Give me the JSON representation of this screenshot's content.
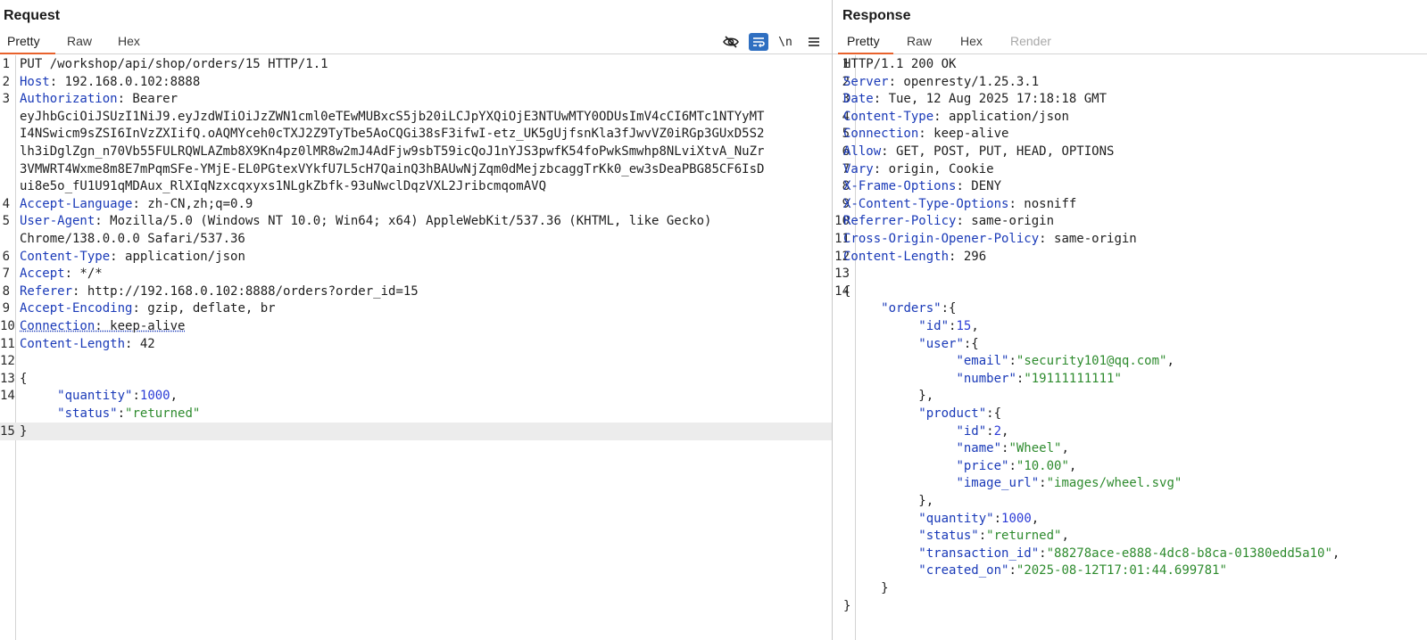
{
  "request": {
    "title": "Request",
    "tabs": [
      "Pretty",
      "Raw",
      "Hex"
    ],
    "active_tab": "Pretty",
    "toolbar": {
      "icons": [
        "hide-eye-icon",
        "wrap-lines-icon",
        "newline-icon",
        "menu-icon"
      ],
      "newline_label": "\\n"
    },
    "lines": [
      {
        "n": "1",
        "parts": [
          {
            "t": "PUT /workshop/api/shop/orders/15 HTTP/1.1",
            "c": "hv"
          }
        ]
      },
      {
        "n": "2",
        "parts": [
          {
            "t": "Host",
            "c": "hk"
          },
          {
            "t": ": 192.168.0.102:8888",
            "c": "hv"
          }
        ]
      },
      {
        "n": "3",
        "parts": [
          {
            "t": "Authorization",
            "c": "hk"
          },
          {
            "t": ": Bearer",
            "c": "hv"
          }
        ]
      },
      {
        "n": "",
        "parts": [
          {
            "t": "eyJhbGciOiJSUzI1NiJ9.eyJzdWIiOiJzZWN1cml0eTEwMUBxcS5jb20iLCJpYXQiOjE3NTUwMTY0ODUsImV4cCI6MTc1NTYyMT",
            "c": "hv"
          }
        ]
      },
      {
        "n": "",
        "parts": [
          {
            "t": "I4NSwicm9sZSI6InVzZXIifQ.oAQMYceh0cTXJ2Z9TyTbe5AoCQGi38sF3ifwI-etz_UK5gUjfsnKla3fJwvVZ0iRGp3GUxD5S2",
            "c": "hv"
          }
        ]
      },
      {
        "n": "",
        "parts": [
          {
            "t": "lh3iDglZgn_n70Vb55FULRQWLAZmb8X9Kn4pz0lMR8w2mJ4AdFjw9sbT59icQoJ1nYJS3pwfK54foPwkSmwhp8NLviXtvA_NuZr",
            "c": "hv"
          }
        ]
      },
      {
        "n": "",
        "parts": [
          {
            "t": "3VMWRT4Wxme8m8E7mPqmSFe-YMjE-EL0PGtexVYkfU7L5cH7QainQ3hBAUwNjZqm0dMejzbcaggTrKk0_ew3sDeaPBG85CF6IsD",
            "c": "hv"
          }
        ]
      },
      {
        "n": "",
        "parts": [
          {
            "t": "ui8e5o_fU1U91qMDAux_RlXIqNzxcqxyxs1NLgkZbfk-93uNwclDqzVXL2JribcmqomAVQ",
            "c": "hv"
          }
        ]
      },
      {
        "n": "4",
        "parts": [
          {
            "t": "Accept-Language",
            "c": "hk"
          },
          {
            "t": ": zh-CN,zh;q=0.9",
            "c": "hv"
          }
        ]
      },
      {
        "n": "5",
        "parts": [
          {
            "t": "User-Agent",
            "c": "hk"
          },
          {
            "t": ": Mozilla/5.0 (Windows NT 10.0; Win64; x64) AppleWebKit/537.36 (KHTML, like Gecko)",
            "c": "hv"
          }
        ]
      },
      {
        "n": "",
        "parts": [
          {
            "t": "Chrome/138.0.0.0 Safari/537.36",
            "c": "hv"
          }
        ]
      },
      {
        "n": "6",
        "parts": [
          {
            "t": "Content-Type",
            "c": "hk"
          },
          {
            "t": ": application/json",
            "c": "hv"
          }
        ]
      },
      {
        "n": "7",
        "parts": [
          {
            "t": "Accept",
            "c": "hk"
          },
          {
            "t": ": */*",
            "c": "hv"
          }
        ]
      },
      {
        "n": "8",
        "parts": [
          {
            "t": "Referer",
            "c": "hk"
          },
          {
            "t": ": http://192.168.0.102:8888/orders?order_id=15",
            "c": "hv"
          }
        ]
      },
      {
        "n": "9",
        "parts": [
          {
            "t": "Accept-Encoding",
            "c": "hk"
          },
          {
            "t": ": gzip, deflate, br",
            "c": "hv"
          }
        ]
      },
      {
        "n": "10",
        "parts": [
          {
            "t": "Connection",
            "c": "hk dotted"
          },
          {
            "t": ": keep-alive",
            "c": "hv dotted"
          }
        ]
      },
      {
        "n": "11",
        "parts": [
          {
            "t": "Content-Length",
            "c": "hk"
          },
          {
            "t": ": 42",
            "c": "hv"
          }
        ]
      },
      {
        "n": "12",
        "parts": []
      },
      {
        "n": "13",
        "parts": [
          {
            "t": "{",
            "c": "jp"
          }
        ]
      },
      {
        "n": "14",
        "parts": [
          {
            "t": "     ",
            "c": "jp"
          },
          {
            "t": "\"quantity\"",
            "c": "jk"
          },
          {
            "t": ":",
            "c": "jp"
          },
          {
            "t": "1000",
            "c": "jn"
          },
          {
            "t": ",",
            "c": "jp"
          }
        ]
      },
      {
        "n": "",
        "parts": [
          {
            "t": "     ",
            "c": "jp"
          },
          {
            "t": "\"status\"",
            "c": "jk"
          },
          {
            "t": ":",
            "c": "jp"
          },
          {
            "t": "\"returned\"",
            "c": "js"
          }
        ]
      },
      {
        "n": "15",
        "parts": [
          {
            "t": "}",
            "c": "jp"
          }
        ],
        "highlight": true
      }
    ]
  },
  "response": {
    "title": "Response",
    "tabs": [
      "Pretty",
      "Raw",
      "Hex",
      "Render"
    ],
    "active_tab": "Pretty",
    "disabled_tab": "Render",
    "lines": [
      {
        "n": "1",
        "parts": [
          {
            "t": "HTTP/1.1 200 OK",
            "c": "hv"
          }
        ]
      },
      {
        "n": "2",
        "parts": [
          {
            "t": "Server",
            "c": "hk"
          },
          {
            "t": ": openresty/1.25.3.1",
            "c": "hv"
          }
        ]
      },
      {
        "n": "3",
        "parts": [
          {
            "t": "Date",
            "c": "hk"
          },
          {
            "t": ": Tue, 12 Aug 2025 17:18:18 GMT",
            "c": "hv"
          }
        ]
      },
      {
        "n": "4",
        "parts": [
          {
            "t": "Content-Type",
            "c": "hk"
          },
          {
            "t": ": application/json",
            "c": "hv"
          }
        ]
      },
      {
        "n": "5",
        "parts": [
          {
            "t": "Connection",
            "c": "hk"
          },
          {
            "t": ": keep-alive",
            "c": "hv"
          }
        ]
      },
      {
        "n": "6",
        "parts": [
          {
            "t": "Allow",
            "c": "hk"
          },
          {
            "t": ": GET, POST, PUT, HEAD, OPTIONS",
            "c": "hv"
          }
        ]
      },
      {
        "n": "7",
        "parts": [
          {
            "t": "Vary",
            "c": "hk"
          },
          {
            "t": ": origin, Cookie",
            "c": "hv"
          }
        ]
      },
      {
        "n": "8",
        "parts": [
          {
            "t": "X-Frame-Options",
            "c": "hk"
          },
          {
            "t": ": DENY",
            "c": "hv"
          }
        ]
      },
      {
        "n": "9",
        "parts": [
          {
            "t": "X-Content-Type-Options",
            "c": "hk"
          },
          {
            "t": ": nosniff",
            "c": "hv"
          }
        ]
      },
      {
        "n": "10",
        "parts": [
          {
            "t": "Referrer-Policy",
            "c": "hk"
          },
          {
            "t": ": same-origin",
            "c": "hv"
          }
        ]
      },
      {
        "n": "11",
        "parts": [
          {
            "t": "Cross-Origin-Opener-Policy",
            "c": "hk"
          },
          {
            "t": ": same-origin",
            "c": "hv"
          }
        ]
      },
      {
        "n": "12",
        "parts": [
          {
            "t": "Content-Length",
            "c": "hk"
          },
          {
            "t": ": 296",
            "c": "hv"
          }
        ]
      },
      {
        "n": "13",
        "parts": []
      },
      {
        "n": "14",
        "parts": [
          {
            "t": "{",
            "c": "jp"
          }
        ]
      },
      {
        "n": "",
        "parts": [
          {
            "t": "     ",
            "c": "jp"
          },
          {
            "t": "\"orders\"",
            "c": "jk"
          },
          {
            "t": ":{",
            "c": "jp"
          }
        ]
      },
      {
        "n": "",
        "parts": [
          {
            "t": "          ",
            "c": "jp"
          },
          {
            "t": "\"id\"",
            "c": "jk"
          },
          {
            "t": ":",
            "c": "jp"
          },
          {
            "t": "15",
            "c": "jn"
          },
          {
            "t": ",",
            "c": "jp"
          }
        ]
      },
      {
        "n": "",
        "parts": [
          {
            "t": "          ",
            "c": "jp"
          },
          {
            "t": "\"user\"",
            "c": "jk"
          },
          {
            "t": ":{",
            "c": "jp"
          }
        ]
      },
      {
        "n": "",
        "parts": [
          {
            "t": "               ",
            "c": "jp"
          },
          {
            "t": "\"email\"",
            "c": "jk"
          },
          {
            "t": ":",
            "c": "jp"
          },
          {
            "t": "\"security101@qq.com\"",
            "c": "js"
          },
          {
            "t": ",",
            "c": "jp"
          }
        ]
      },
      {
        "n": "",
        "parts": [
          {
            "t": "               ",
            "c": "jp"
          },
          {
            "t": "\"number\"",
            "c": "jk"
          },
          {
            "t": ":",
            "c": "jp"
          },
          {
            "t": "\"19111111111\"",
            "c": "js"
          }
        ]
      },
      {
        "n": "",
        "parts": [
          {
            "t": "          },",
            "c": "jp"
          }
        ]
      },
      {
        "n": "",
        "parts": [
          {
            "t": "          ",
            "c": "jp"
          },
          {
            "t": "\"product\"",
            "c": "jk"
          },
          {
            "t": ":{",
            "c": "jp"
          }
        ]
      },
      {
        "n": "",
        "parts": [
          {
            "t": "               ",
            "c": "jp"
          },
          {
            "t": "\"id\"",
            "c": "jk"
          },
          {
            "t": ":",
            "c": "jp"
          },
          {
            "t": "2",
            "c": "jn"
          },
          {
            "t": ",",
            "c": "jp"
          }
        ]
      },
      {
        "n": "",
        "parts": [
          {
            "t": "               ",
            "c": "jp"
          },
          {
            "t": "\"name\"",
            "c": "jk"
          },
          {
            "t": ":",
            "c": "jp"
          },
          {
            "t": "\"Wheel\"",
            "c": "js"
          },
          {
            "t": ",",
            "c": "jp"
          }
        ]
      },
      {
        "n": "",
        "parts": [
          {
            "t": "               ",
            "c": "jp"
          },
          {
            "t": "\"price\"",
            "c": "jk"
          },
          {
            "t": ":",
            "c": "jp"
          },
          {
            "t": "\"10.00\"",
            "c": "js"
          },
          {
            "t": ",",
            "c": "jp"
          }
        ]
      },
      {
        "n": "",
        "parts": [
          {
            "t": "               ",
            "c": "jp"
          },
          {
            "t": "\"image_url\"",
            "c": "jk"
          },
          {
            "t": ":",
            "c": "jp"
          },
          {
            "t": "\"images/wheel.svg\"",
            "c": "js"
          }
        ]
      },
      {
        "n": "",
        "parts": [
          {
            "t": "          },",
            "c": "jp"
          }
        ]
      },
      {
        "n": "",
        "parts": [
          {
            "t": "          ",
            "c": "jp"
          },
          {
            "t": "\"quantity\"",
            "c": "jk"
          },
          {
            "t": ":",
            "c": "jp"
          },
          {
            "t": "1000",
            "c": "jn"
          },
          {
            "t": ",",
            "c": "jp"
          }
        ]
      },
      {
        "n": "",
        "parts": [
          {
            "t": "          ",
            "c": "jp"
          },
          {
            "t": "\"status\"",
            "c": "jk"
          },
          {
            "t": ":",
            "c": "jp"
          },
          {
            "t": "\"returned\"",
            "c": "js"
          },
          {
            "t": ",",
            "c": "jp"
          }
        ]
      },
      {
        "n": "",
        "parts": [
          {
            "t": "          ",
            "c": "jp"
          },
          {
            "t": "\"transaction_id\"",
            "c": "jk"
          },
          {
            "t": ":",
            "c": "jp"
          },
          {
            "t": "\"88278ace-e888-4dc8-b8ca-01380edd5a10\"",
            "c": "js"
          },
          {
            "t": ",",
            "c": "jp"
          }
        ]
      },
      {
        "n": "",
        "parts": [
          {
            "t": "          ",
            "c": "jp"
          },
          {
            "t": "\"created_on\"",
            "c": "jk"
          },
          {
            "t": ":",
            "c": "jp"
          },
          {
            "t": "\"2025-08-12T17:01:44.699781\"",
            "c": "js"
          }
        ]
      },
      {
        "n": "",
        "parts": [
          {
            "t": "     }",
            "c": "jp"
          }
        ]
      },
      {
        "n": "",
        "parts": [
          {
            "t": "}",
            "c": "jp"
          }
        ]
      }
    ]
  },
  "colors": {
    "header_key": "#1a3ab8",
    "json_string": "#2e8b2e",
    "json_number": "#2b3bd6",
    "active_tab_underline": "#e8622c",
    "wrap_button_bg": "#2f6fc1"
  }
}
